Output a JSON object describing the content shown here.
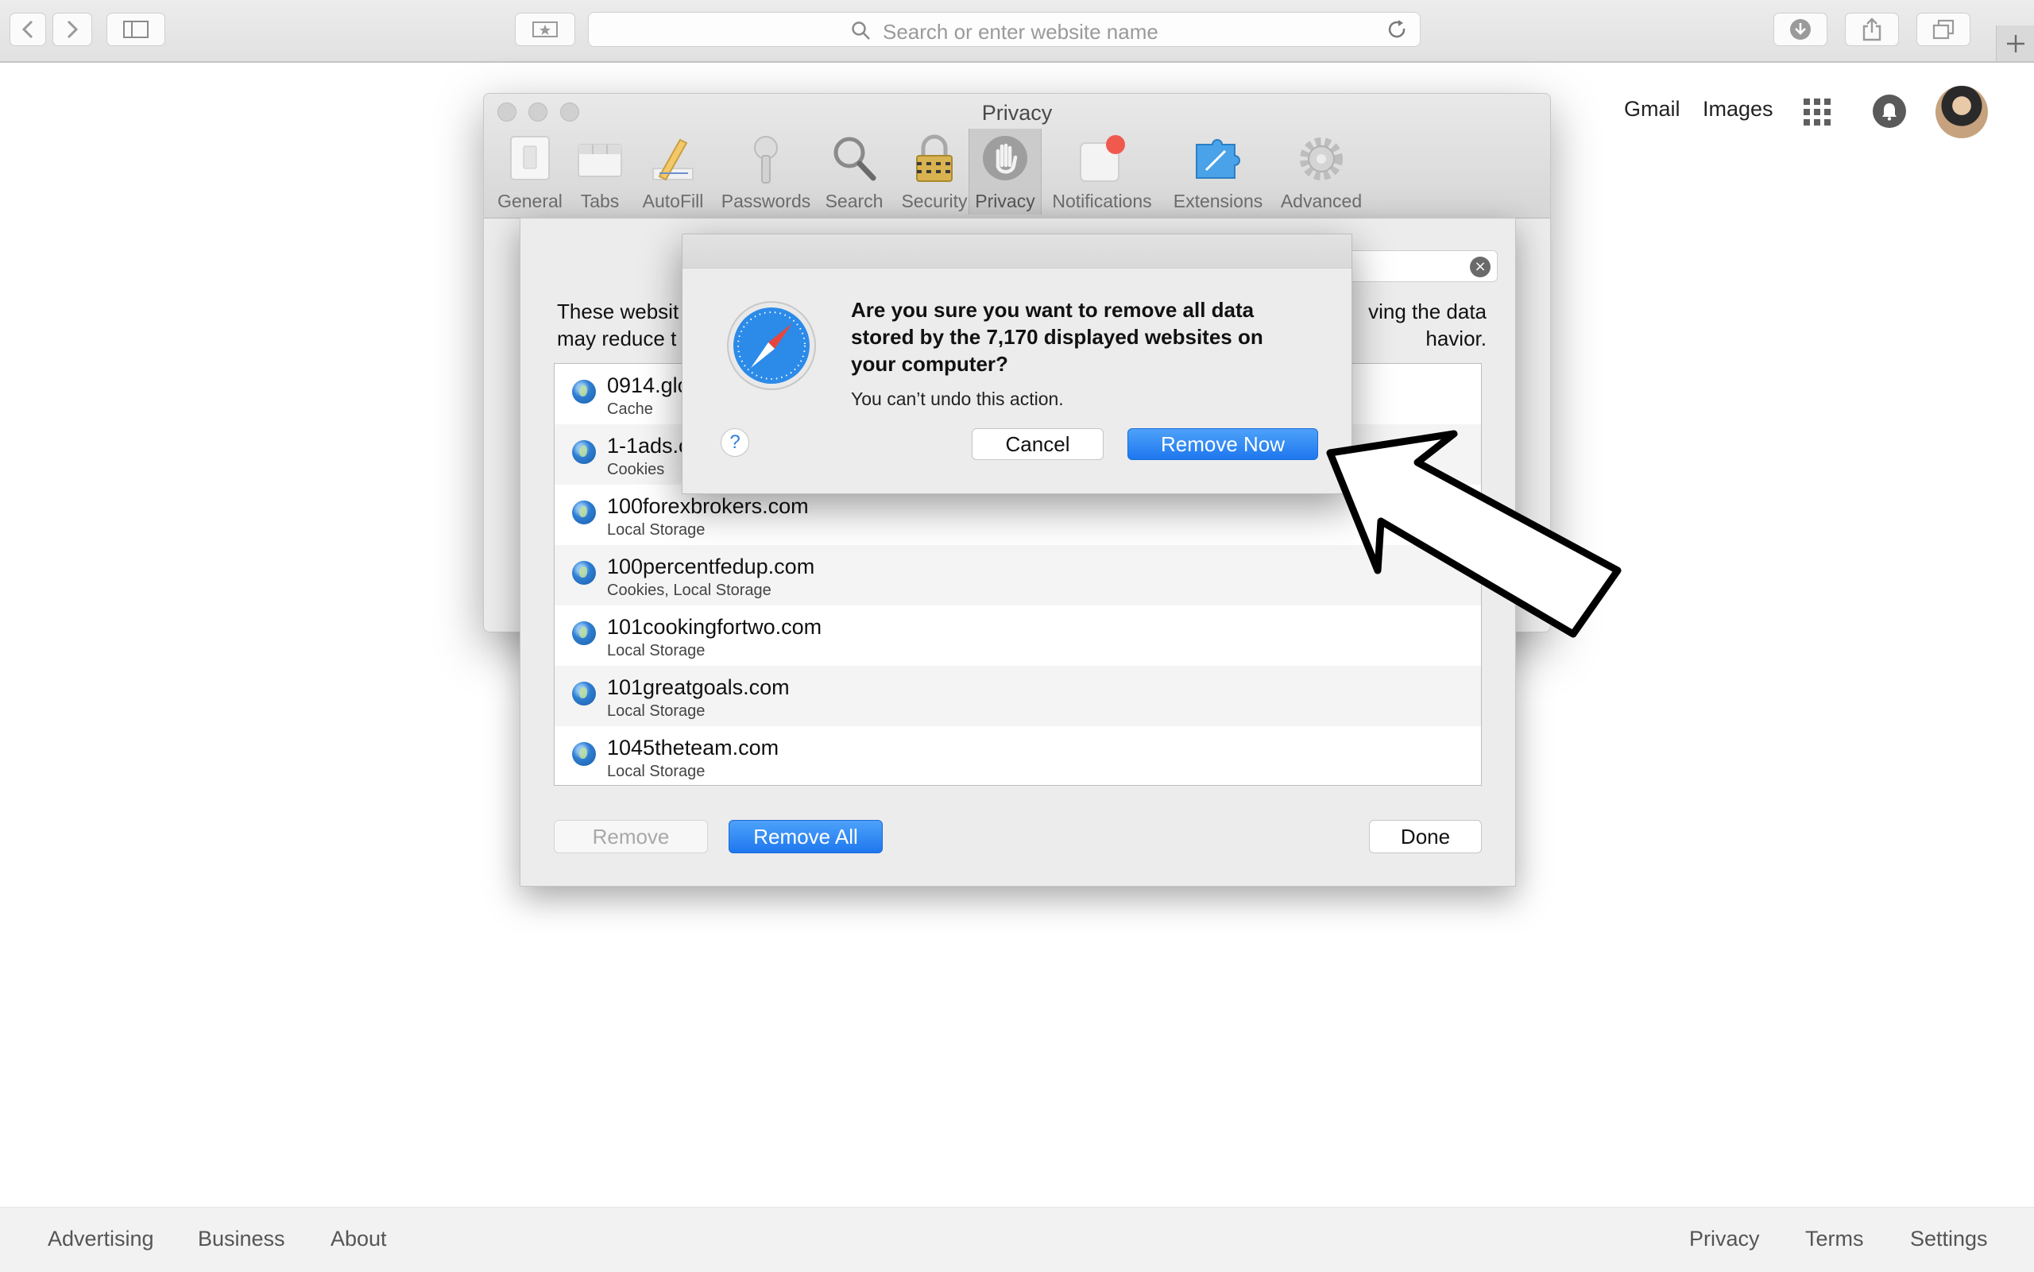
{
  "browser": {
    "url_placeholder": "Search or enter website name"
  },
  "google": {
    "top_links": [
      "Gmail",
      "Images"
    ],
    "footer_left": [
      "Advertising",
      "Business",
      "About"
    ],
    "footer_right": [
      "Privacy",
      "Terms",
      "Settings"
    ]
  },
  "prefs": {
    "title": "Privacy",
    "tabs": [
      {
        "label": "General",
        "icon": "general-icon"
      },
      {
        "label": "Tabs",
        "icon": "tabs-icon"
      },
      {
        "label": "AutoFill",
        "icon": "autofill-icon"
      },
      {
        "label": "Passwords",
        "icon": "key-icon"
      },
      {
        "label": "Search",
        "icon": "search-icon"
      },
      {
        "label": "Security",
        "icon": "lock-icon"
      },
      {
        "label": "Privacy",
        "icon": "hand-icon",
        "active": true
      },
      {
        "label": "Notifications",
        "icon": "notifications-icon"
      },
      {
        "label": "Extensions",
        "icon": "puzzle-icon"
      },
      {
        "label": "Advanced",
        "icon": "gear-icon"
      }
    ]
  },
  "sheet": {
    "desc_left_1": "These websit",
    "desc_left_2": "may reduce t",
    "desc_right_1": "ving the data",
    "desc_right_2": "havior.",
    "sites": [
      {
        "domain": "0914.glo",
        "kind": "Cache"
      },
      {
        "domain": "1-1ads.c",
        "kind": "Cookies"
      },
      {
        "domain": "100forexbrokers.com",
        "kind": "Local Storage"
      },
      {
        "domain": "100percentfedup.com",
        "kind": "Cookies, Local Storage"
      },
      {
        "domain": "101cookingfortwo.com",
        "kind": "Local Storage"
      },
      {
        "domain": "101greatgoals.com",
        "kind": "Local Storage"
      },
      {
        "domain": "1045theteam.com",
        "kind": "Local Storage"
      }
    ],
    "remove_label": "Remove",
    "remove_all_label": "Remove All",
    "done_label": "Done"
  },
  "alert": {
    "message": "Are you sure you want to remove all data stored by the 7,170 displayed websites on your computer?",
    "info": "You can’t undo this action.",
    "help_label": "?",
    "cancel_label": "Cancel",
    "confirm_label": "Remove Now"
  },
  "colors": {
    "accent_blue": "#1e77ef",
    "chrome_bg": "#e1e1e1",
    "footer_bg": "#f2f2f2"
  }
}
